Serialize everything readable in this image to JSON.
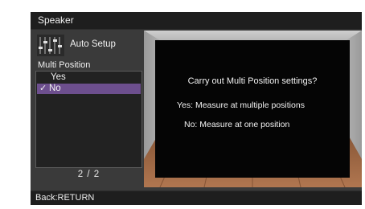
{
  "header": {
    "title": "Speaker"
  },
  "menu": {
    "item": "Auto Setup",
    "icon": "equalizer-sliders-icon"
  },
  "section": {
    "label": "Multi Position"
  },
  "options": {
    "items": [
      {
        "label": "Yes",
        "selected": false
      },
      {
        "label": "No",
        "selected": true,
        "check_glyph": "✓"
      }
    ],
    "page": "2 / 2"
  },
  "dialog": {
    "question": "Carry out Multi Position settings?",
    "yes_line": "Yes:  Measure at multiple positions",
    "no_line": "No:  Measure at one position"
  },
  "footer": {
    "hint": "Back:RETURN"
  },
  "colors": {
    "screen_bg": "#3a3a3a",
    "bar_bg": "#1e1e1e",
    "highlight": "#6d4f8e",
    "message_bg": "#050505"
  }
}
